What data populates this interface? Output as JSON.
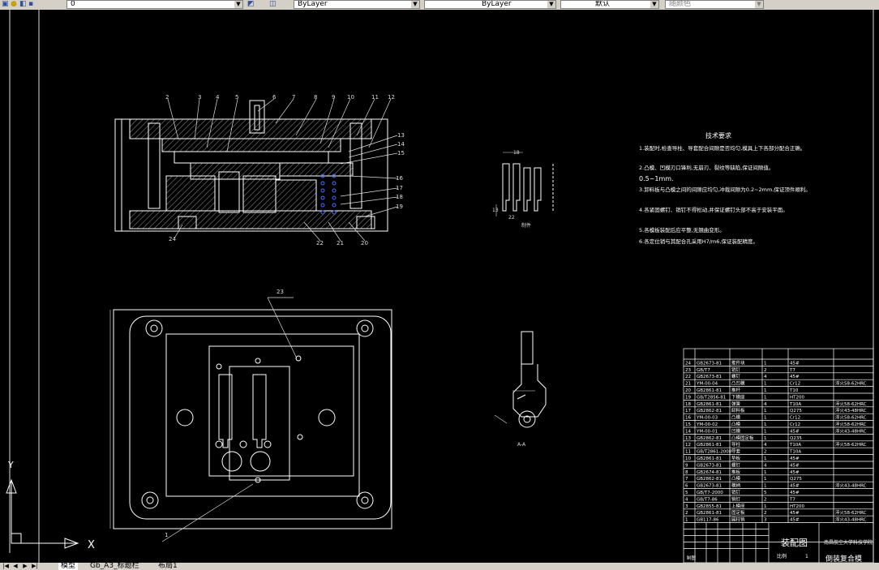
{
  "toolbar": {
    "layer_value": "0",
    "color_value": "ByLayer",
    "linetype_value": "ByLayer",
    "lineweight_value": "默认",
    "plotstyle_value": "随颜色"
  },
  "tabs": [
    {
      "label": "模型",
      "active": true
    },
    {
      "label": "Gb_A3_标题栏"
    },
    {
      "label": "布局1"
    }
  ],
  "ucs": {
    "x_label": "X",
    "y_label": "Y"
  },
  "drawing": {
    "callouts": [
      "1",
      "2",
      "3",
      "4",
      "5",
      "6",
      "7",
      "8",
      "9",
      "10",
      "11",
      "12",
      "13",
      "14",
      "15",
      "16",
      "17",
      "18",
      "19",
      "20",
      "21",
      "22",
      "23",
      "24"
    ],
    "tech_title": "技术要求",
    "tech_lines": [
      "1.装配时,检查导柱、导套配合间隙是否均匀,模具上下各部分配合正确。",
      "2.凸模、凹模刃口锋利,无崩刃、裂纹等缺陷,保证间隙值。",
      "0.5~1mm.",
      "3.卸料板与凸模之间的间隙应均匀,冲裁间隙为0.2~2mm,保证顶件顺利。",
      "4.各紧固螺钉、销钉不得松动,并保证螺钉头部不高于安装平面。",
      "5.各模板装配后应平整,无翘曲变形。",
      "6.各定位销与其配合孔采用H7/m6,保证装配精度。"
    ],
    "part_dims": {
      "top": "18",
      "left": "13",
      "bottom": "22"
    },
    "part_label": "制件",
    "sec_label": "A-A",
    "bom_rows": [
      [
        "24",
        "GB2673-81",
        "推件块",
        "1",
        "45#",
        ""
      ],
      [
        "23",
        "GB/T7",
        "销钉",
        "2",
        "T7",
        ""
      ],
      [
        "22",
        "GB2673-81",
        "螺钉",
        "4",
        "45#",
        ""
      ],
      [
        "21",
        "YM-00-04",
        "凸凹模",
        "1",
        "Cr12",
        "淬火58-62HRC"
      ],
      [
        "20",
        "GB2861-81",
        "推杆",
        "1",
        "T10",
        ""
      ],
      [
        "19",
        "GB/T2856-81",
        "下模座",
        "1",
        "HT200",
        ""
      ],
      [
        "18",
        "GB2861-81",
        "弹簧",
        "4",
        "T10A",
        "淬火58-62HRC"
      ],
      [
        "17",
        "GB2862-81",
        "卸料板",
        "1",
        "Q275",
        "淬火43-48HRC"
      ],
      [
        "16",
        "YM-00-03",
        "凸模",
        "1",
        "Cr12",
        "淬火58-62HRC"
      ],
      [
        "15",
        "YM-00-02",
        "凸模",
        "1",
        "Cr12",
        "淬火58-62HRC"
      ],
      [
        "14",
        "YM-00-01",
        "凹模",
        "1",
        "45#",
        "淬火43-48HRC"
      ],
      [
        "13",
        "GB2862-81",
        "凸模固定板",
        "1",
        "Q235",
        ""
      ],
      [
        "12",
        "GB2861-81",
        "导柱",
        "4",
        "T10A",
        "淬火58-62HRC"
      ],
      [
        "11",
        "GB/T2861-2008",
        "导套",
        "2",
        "T10A",
        ""
      ],
      [
        "10",
        "GB2861-81",
        "垫板",
        "1",
        "45#",
        ""
      ],
      [
        "9",
        "GB2673-81",
        "螺钉",
        "4",
        "45#",
        ""
      ],
      [
        "8",
        "GB2674-81",
        "推板",
        "1",
        "45#",
        ""
      ],
      [
        "7",
        "GB2862-81",
        "凸模",
        "1",
        "Q275",
        ""
      ],
      [
        "6",
        "GB2673-81",
        "模柄",
        "1",
        "45#",
        "淬火43-48HRC"
      ],
      [
        "5",
        "GB/T7-2000",
        "销钉",
        "5",
        "45#",
        ""
      ],
      [
        "4",
        "GB/T7-86",
        "销钉",
        "2",
        "T7",
        ""
      ],
      [
        "3",
        "GB2855-81",
        "上模座",
        "1",
        "HT200",
        ""
      ],
      [
        "2",
        "GB2861-81",
        "固定板",
        "2",
        "45#",
        "淬火58-62HRC"
      ],
      [
        "1",
        "GB117-86",
        "圆柱销",
        "3",
        "45#",
        "淬火43-48HRC"
      ]
    ],
    "title_block": {
      "title": "装配图",
      "school": "南昌航空大学科技学院",
      "scale_label": "比例",
      "scale_value": "1",
      "designer_label": "制图",
      "company": "倒装复合模"
    }
  }
}
